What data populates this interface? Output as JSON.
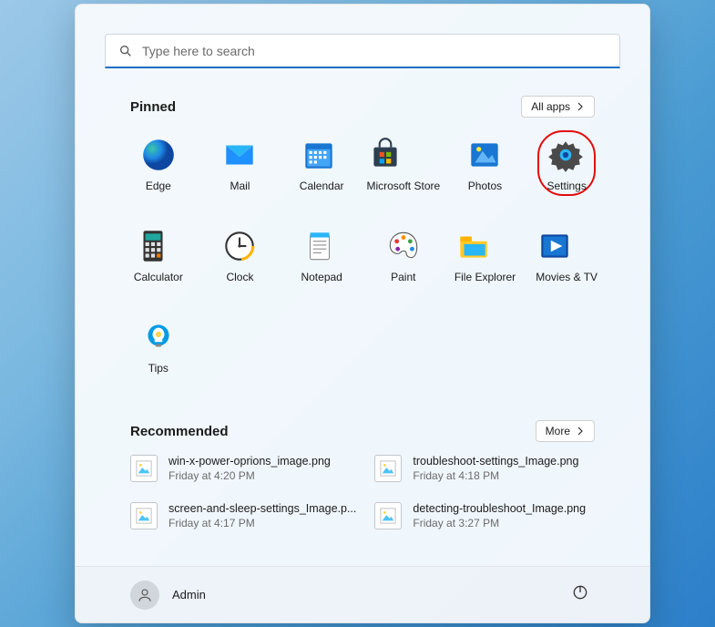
{
  "search": {
    "placeholder": "Type here to search"
  },
  "pinned": {
    "title": "Pinned",
    "all_apps_label": "All apps",
    "apps": [
      {
        "label": "Edge",
        "icon": "edge-icon"
      },
      {
        "label": "Mail",
        "icon": "mail-icon"
      },
      {
        "label": "Calendar",
        "icon": "calendar-icon"
      },
      {
        "label": "Microsoft Store",
        "icon": "store-icon"
      },
      {
        "label": "Photos",
        "icon": "photos-icon"
      },
      {
        "label": "Settings",
        "icon": "settings-icon",
        "highlighted": true
      },
      {
        "label": "Calculator",
        "icon": "calculator-icon"
      },
      {
        "label": "Clock",
        "icon": "clock-icon"
      },
      {
        "label": "Notepad",
        "icon": "notepad-icon"
      },
      {
        "label": "Paint",
        "icon": "paint-icon"
      },
      {
        "label": "File Explorer",
        "icon": "file-explorer-icon"
      },
      {
        "label": "Movies & TV",
        "icon": "movies-tv-icon"
      },
      {
        "label": "Tips",
        "icon": "tips-icon"
      }
    ]
  },
  "recommended": {
    "title": "Recommended",
    "more_label": "More",
    "items": [
      {
        "title": "win-x-power-oprions_image.png",
        "time": "Friday at 4:20 PM"
      },
      {
        "title": "troubleshoot-settings_Image.png",
        "time": "Friday at 4:18 PM"
      },
      {
        "title": "screen-and-sleep-settings_Image.p...",
        "time": "Friday at 4:17 PM"
      },
      {
        "title": "detecting-troubleshoot_Image.png",
        "time": "Friday at 3:27 PM"
      }
    ]
  },
  "footer": {
    "user": "Admin"
  }
}
